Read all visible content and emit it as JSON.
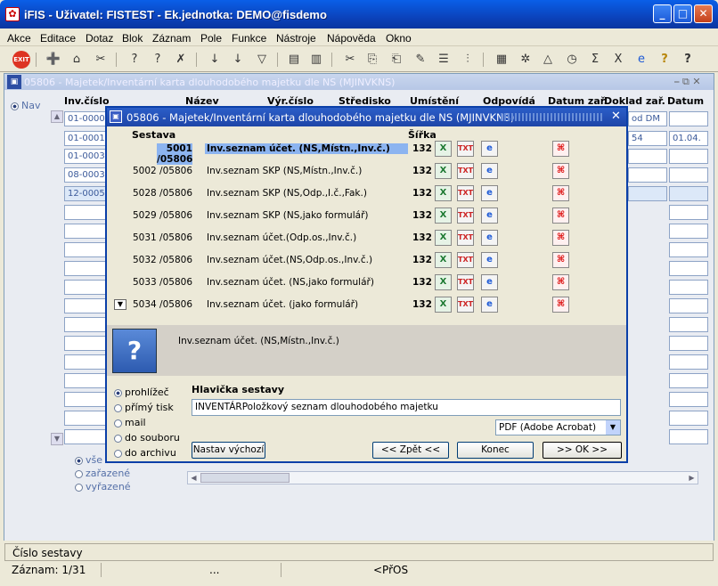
{
  "window": {
    "title": "iFIS - Uživatel: FISTEST - Ek.jednotka: DEMO@fisdemo"
  },
  "menu": [
    "Akce",
    "Editace",
    "Dotaz",
    "Blok",
    "Záznam",
    "Pole",
    "Funkce",
    "Nástroje",
    "Nápověda",
    "Okno"
  ],
  "form": {
    "title": "05806 - Majetek/Inventární karta dlouhodobého majetku dle NS (MJINVKNS)",
    "nav_label": "Nav",
    "columns": [
      "Inv.číslo",
      "Název",
      "Výr.číslo",
      "Středisko",
      "Umístění",
      "Odpovídá",
      "Datum zař.",
      "Doklad zař.",
      "Datum"
    ],
    "inv_numbers": [
      "01-0000",
      "01-00013",
      "01-00033",
      "08-0003",
      "12-00053"
    ],
    "right_col1": [
      "od DM",
      "54"
    ],
    "right_col2": [
      "",
      "01.04."
    ],
    "filters": [
      "vše",
      "zařazené",
      "vyřazené"
    ]
  },
  "dialog": {
    "title": "05806 - Majetek/Inventární karta dlouhodobého majetku dle NS (MJINVKNS)",
    "col_sestava": "Sestava",
    "col_sirka": "Šířka",
    "reports": [
      {
        "code": "5001 /05806",
        "name": "Inv.seznam účet. (NS,Místn.,Inv.č.)",
        "width": "132"
      },
      {
        "code": "5002 /05806",
        "name": "Inv.seznam SKP (NS,Místn.,Inv.č.)",
        "width": "132"
      },
      {
        "code": "5028 /05806",
        "name": "Inv.seznam SKP (NS,Odp.,I.č.,Fak.)",
        "width": "132"
      },
      {
        "code": "5029 /05806",
        "name": "Inv.seznam SKP (NS,jako formulář)",
        "width": "132"
      },
      {
        "code": "5031 /05806",
        "name": "Inv.seznam účet.(Odp.os.,Inv.č.)",
        "width": "132"
      },
      {
        "code": "5032 /05806",
        "name": "Inv.seznam účet.(NS,Odp.os.,Inv.č.)",
        "width": "132"
      },
      {
        "code": "5033 /05806",
        "name": "Inv.seznam účet. (NS,jako formulář)",
        "width": "132"
      },
      {
        "code": "5034 /05806",
        "name": "Inv.seznam účet. (jako formulář)",
        "width": "132"
      }
    ],
    "selected_report_desc": "Inv.seznam účet. (NS,Místn.,Inv.č.)",
    "output_options": [
      "prohlížeč",
      "přímý tisk",
      "mail",
      "do souboru",
      "do archivu"
    ],
    "selected_output": "prohlížeč",
    "header_label": "Hlavička sestavy",
    "header_value": "INVENTÁRPoložkový seznam dlouhodobého majetku",
    "format": "PDF (Adobe Acrobat)",
    "buttons": {
      "reset": "Nastav výchozí",
      "back": "<< Zpět <<",
      "end": "Konec",
      "ok": ">> OK >>"
    }
  },
  "status": {
    "hint": "Číslo sestavy",
    "record": "Záznam: 1/31",
    "ellipsis": "...",
    "mode": "<PřOS"
  }
}
